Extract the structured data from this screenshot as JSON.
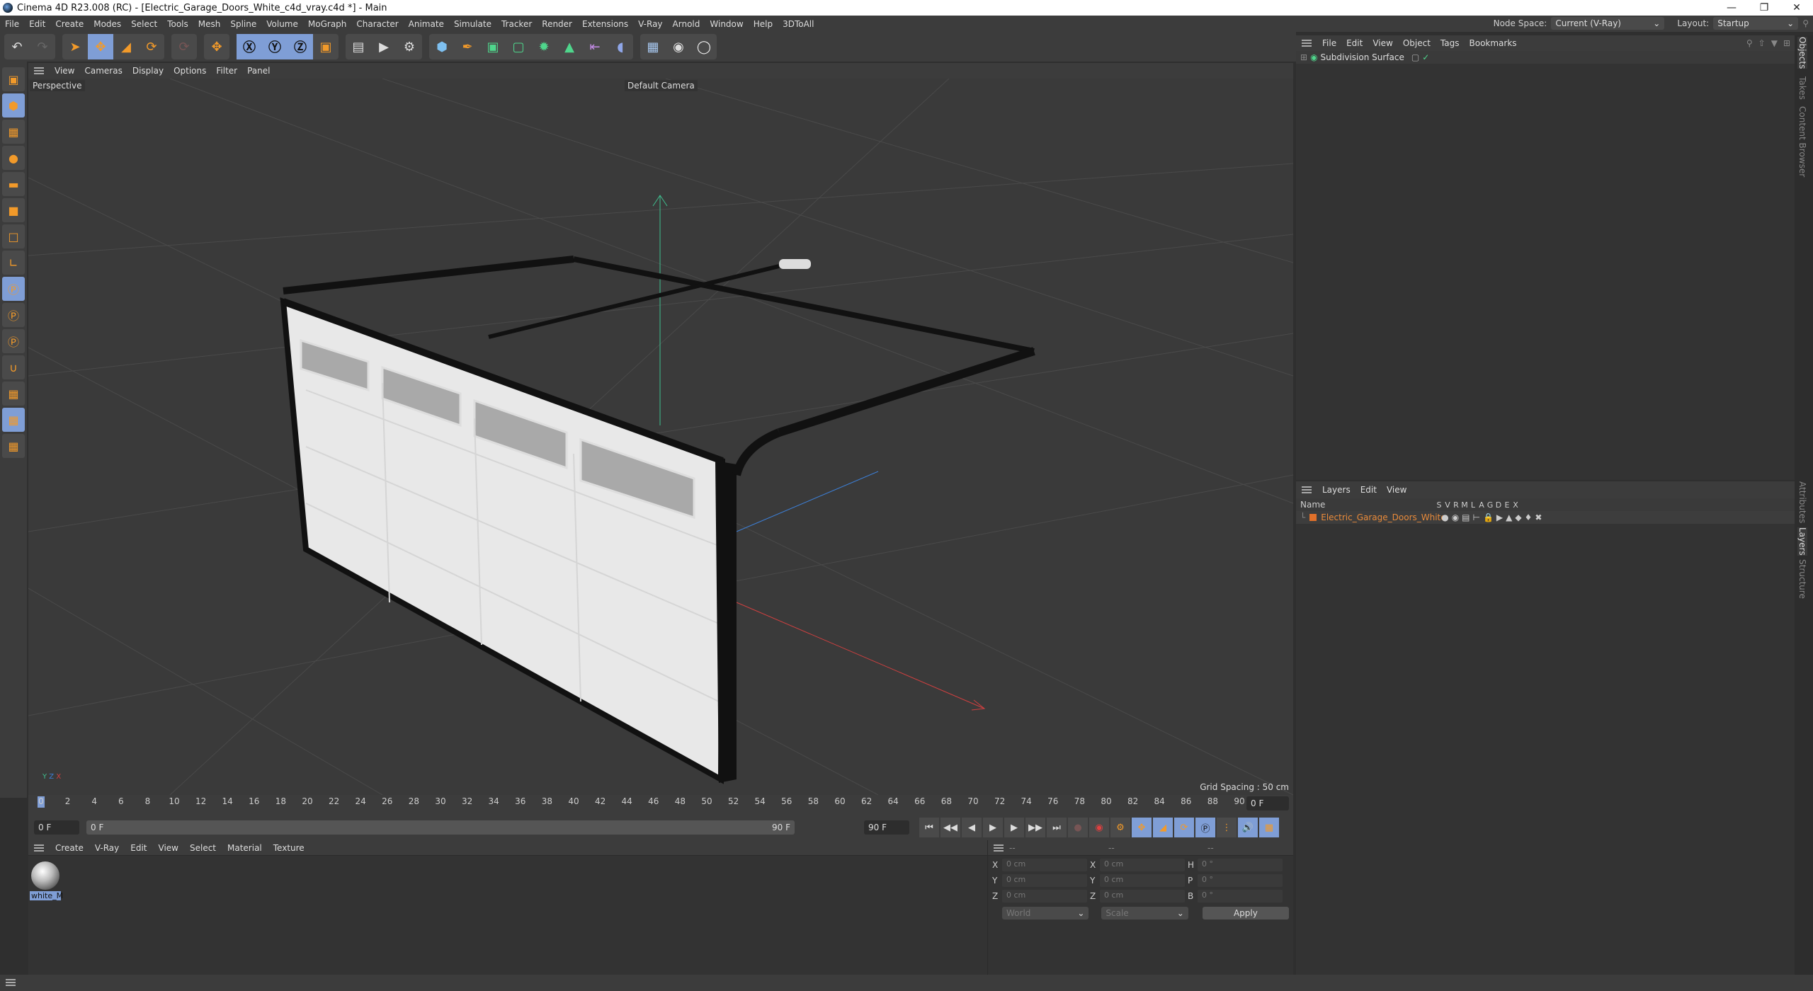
{
  "window": {
    "title": "Cinema 4D R23.008 (RC) - [Electric_Garage_Doors_White_c4d_vray.c4d *] - Main",
    "controls": [
      "minimize",
      "restore",
      "close"
    ]
  },
  "menubar": {
    "items": [
      "File",
      "Edit",
      "Create",
      "Modes",
      "Select",
      "Tools",
      "Mesh",
      "Spline",
      "Volume",
      "MoGraph",
      "Character",
      "Animate",
      "Simulate",
      "Tracker",
      "Render",
      "Extensions",
      "V-Ray",
      "Arnold",
      "Window",
      "Help",
      "3DToAll"
    ],
    "node_space_label": "Node Space:",
    "node_space_value": "Current (V-Ray)",
    "layout_label": "Layout:",
    "layout_value": "Startup"
  },
  "toolbar": {
    "icons": [
      "undo-icon",
      "redo-icon",
      "select-icon",
      "move-icon",
      "scale-icon",
      "rotate-icon",
      "psr-icon",
      "axis-move-icon",
      "x-axis-icon",
      "y-axis-icon",
      "z-axis-icon",
      "coordinate-system-icon",
      "render-view-icon",
      "render-icon",
      "render-settings-icon",
      "cube-icon",
      "pen-icon",
      "subdivision-icon",
      "extrude-icon",
      "mograph-cloner-icon",
      "array-icon",
      "bend-icon",
      "deformer-icon",
      "floor-icon",
      "camera-icon",
      "light-icon"
    ]
  },
  "lefttools": [
    "make-editable-icon",
    "model-mode-icon",
    "texture-mode-icon",
    "point-mode-icon",
    "edge-mode-icon",
    "polygon-mode-icon",
    "uv-mode-icon",
    "axis-mode-icon",
    "snap-icon",
    "snap-settings-icon",
    "solo-icon",
    "magnet-icon",
    "workplane-icon",
    "locked-workplane-icon",
    "workplane-rotate-icon"
  ],
  "viewport": {
    "menu": [
      "View",
      "Cameras",
      "Display",
      "Options",
      "Filter",
      "Panel"
    ],
    "name": "Perspective",
    "camera": "Default Camera",
    "grid_spacing": "Grid Spacing : 50 cm"
  },
  "timeline": {
    "ticks": [
      "0",
      "2",
      "4",
      "6",
      "8",
      "10",
      "12",
      "14",
      "16",
      "18",
      "20",
      "22",
      "24",
      "26",
      "28",
      "30",
      "32",
      "34",
      "36",
      "38",
      "40",
      "42",
      "44",
      "46",
      "48",
      "50",
      "52",
      "54",
      "56",
      "58",
      "60",
      "62",
      "64",
      "66",
      "68",
      "70",
      "72",
      "74",
      "76",
      "78",
      "80",
      "82",
      "84",
      "86",
      "88",
      "90"
    ],
    "current_frame": "0 F"
  },
  "transport": {
    "start": "0 F",
    "range_start": "0 F",
    "range_end": "90 F",
    "end": "90 F"
  },
  "materials": {
    "menu": [
      "Create",
      "V-Ray",
      "Edit",
      "View",
      "Select",
      "Material",
      "Texture"
    ],
    "items": [
      {
        "name": "white_M"
      }
    ]
  },
  "coords": {
    "headers": [
      "--",
      "--",
      "--"
    ],
    "pos": [
      {
        "axis": "X",
        "value": "0 cm"
      },
      {
        "axis": "Y",
        "value": "0 cm"
      },
      {
        "axis": "Z",
        "value": "0 cm"
      }
    ],
    "scale": [
      {
        "axis": "X",
        "value": "0 cm"
      },
      {
        "axis": "Y",
        "value": "0 cm"
      },
      {
        "axis": "Z",
        "value": "0 cm"
      }
    ],
    "rot": [
      {
        "axis": "H",
        "value": "0 °"
      },
      {
        "axis": "P",
        "value": "0 °"
      },
      {
        "axis": "B",
        "value": "0 °"
      }
    ],
    "mode": "World",
    "type": "Scale",
    "apply": "Apply"
  },
  "objects": {
    "menu": [
      "File",
      "Edit",
      "View",
      "Object",
      "Tags",
      "Bookmarks"
    ],
    "items": [
      {
        "name": "Subdivision Surface"
      }
    ]
  },
  "layers": {
    "menu": [
      "Layers",
      "Edit",
      "View"
    ],
    "columns": [
      "Name",
      "S",
      "V",
      "R",
      "M",
      "L",
      "A",
      "G",
      "D",
      "E",
      "X"
    ],
    "rows": [
      {
        "name": "Electric_Garage_Doors_White",
        "color": "#e0702a"
      }
    ]
  },
  "sidetabs": {
    "top": [
      "Objects",
      "Takes",
      "Content Browser"
    ],
    "bottom": [
      "Attributes",
      "Layers",
      "Structure"
    ]
  },
  "colors": {
    "accent": "#7f9ed6",
    "orange": "#f29a2a",
    "layer": "#e88a3a",
    "axis_x": "#d04040",
    "axis_y": "#3fbf8f",
    "axis_z": "#3d7fd6"
  }
}
